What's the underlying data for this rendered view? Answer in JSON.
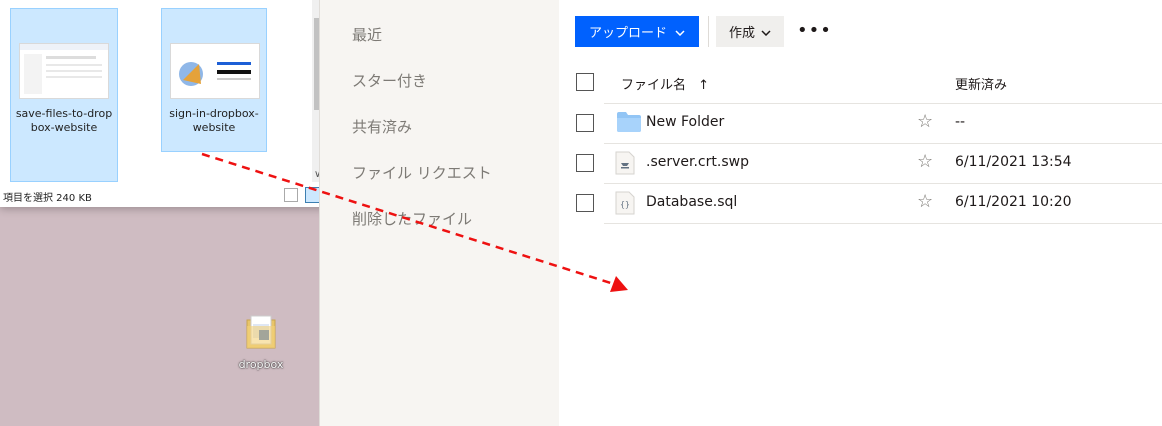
{
  "explorer": {
    "items": [
      {
        "caption": "save-files-to-dropbox-website"
      },
      {
        "caption": "sign-in-dropbox-website"
      }
    ],
    "status_text": "項目を選択  240 KB"
  },
  "desktop": {
    "icon_label": "dropbox"
  },
  "sidebar": {
    "items": [
      "最近",
      "スター付き",
      "共有済み",
      "ファイル リクエスト",
      "削除したファイル"
    ]
  },
  "toolbar": {
    "upload_label": "アップロード",
    "create_label": "作成",
    "more_label": "•••"
  },
  "table": {
    "header_name": "ファイル名",
    "header_sort": "↑",
    "header_modified": "更新済み",
    "rows": [
      {
        "name": "New Folder",
        "modified": "--",
        "icon": "folder-icon"
      },
      {
        "name": ".server.crt.swp",
        "modified": "6/11/2021 13:54",
        "icon": "file-icon"
      },
      {
        "name": "Database.sql",
        "modified": "6/11/2021 10:20",
        "icon": "code-file-icon"
      }
    ]
  },
  "colors": {
    "accent": "#0061fe",
    "arrow": "#ee1111"
  }
}
